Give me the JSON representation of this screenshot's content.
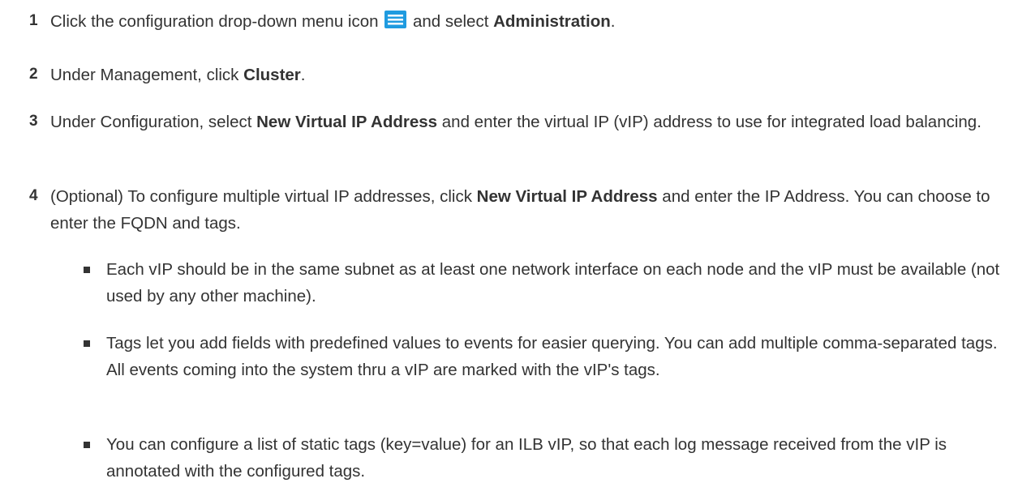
{
  "steps": [
    {
      "num": "1",
      "pre": "Click the configuration drop-down menu icon",
      "icon": "menu-icon",
      "mid": "and select",
      "bold": "Administration",
      "post": "."
    },
    {
      "num": "2",
      "pre": "Under Management, click",
      "bold": "Cluster",
      "post": "."
    },
    {
      "num": "3",
      "pre": "Under Configuration, select",
      "bold": "New Virtual IP Address",
      "post": "and enter the virtual IP (vIP) address to use for integrated load balancing."
    },
    {
      "num": "4",
      "pre": "(Optional) To configure multiple virtual IP addresses, click",
      "bold": "New Virtual IP Address",
      "post": "and enter the IP Address. You can choose to enter the FQDN and tags."
    }
  ],
  "bullets": [
    "Each vIP should be in the same subnet as at least one network interface on each node and the vIP must be available (not used by any other machine).",
    "Tags let you add fields with predefined values to events for easier querying. You can add multiple comma-separated tags. All events coming into the system thru a vIP are marked with the vIP's tags.",
    "You can configure a list of static tags (key=value) for an ILB vIP, so that each log message received from the vIP is annotated with the configured tags."
  ],
  "colors": {
    "text": "#333333",
    "icon": "#1f9be0"
  }
}
